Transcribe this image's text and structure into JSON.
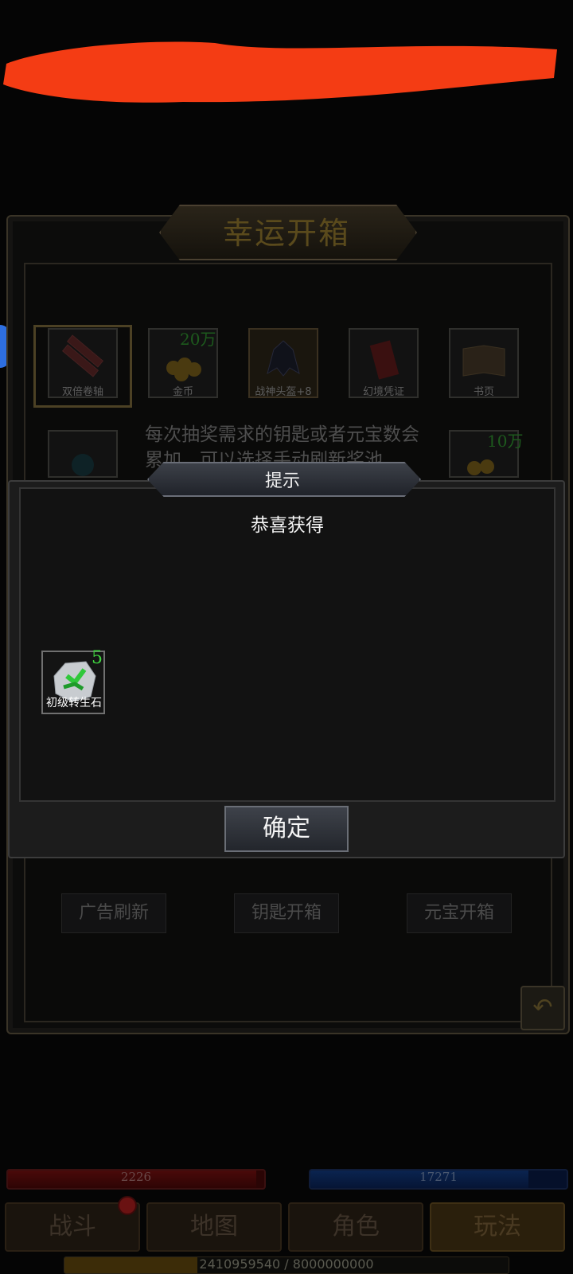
{
  "colors": {
    "redaction": "#f43c14",
    "reward_count": "#3fd33f",
    "hp": "#4a0a0a",
    "mp": "#0a2450"
  },
  "lucky_box": {
    "title": "幸运开箱",
    "items": [
      {
        "name": "双倍卷轴",
        "icon": "scroll-bundle-icon",
        "count": ""
      },
      {
        "name": "金币",
        "icon": "gold-coins-icon",
        "count": "20万"
      },
      {
        "name": "战神头盔+8",
        "icon": "helmet-icon",
        "count": ""
      },
      {
        "name": "幻境凭证",
        "icon": "voucher-scroll-icon",
        "count": ""
      },
      {
        "name": "书页",
        "icon": "book-pages-icon",
        "count": ""
      }
    ],
    "row2_right_count": "10万",
    "description": "每次抽奖需求的钥匙或者元宝数会累加，可以选择手动刷新奖池",
    "buttons": {
      "ad_refresh": "广告刷新",
      "key_open": "钥匙开箱",
      "ingot_open": "元宝开箱"
    },
    "back_icon": "undo-arrow-icon"
  },
  "dialog": {
    "title": "提示",
    "message": "恭喜获得",
    "reward": {
      "name": "初级转生石",
      "count": "5",
      "icon": "rebirth-stone-icon"
    },
    "confirm_label": "确定"
  },
  "hud": {
    "hp_value": "2226",
    "hp_fraction": 0.97,
    "mp_value": "17271",
    "mp_fraction": 0.85,
    "exp_text": "2410959540 / 8000000000",
    "exp_fraction": 0.3
  },
  "nav": {
    "battle": "战斗",
    "map": "地图",
    "character": "角色",
    "gameplay": "玩法"
  }
}
